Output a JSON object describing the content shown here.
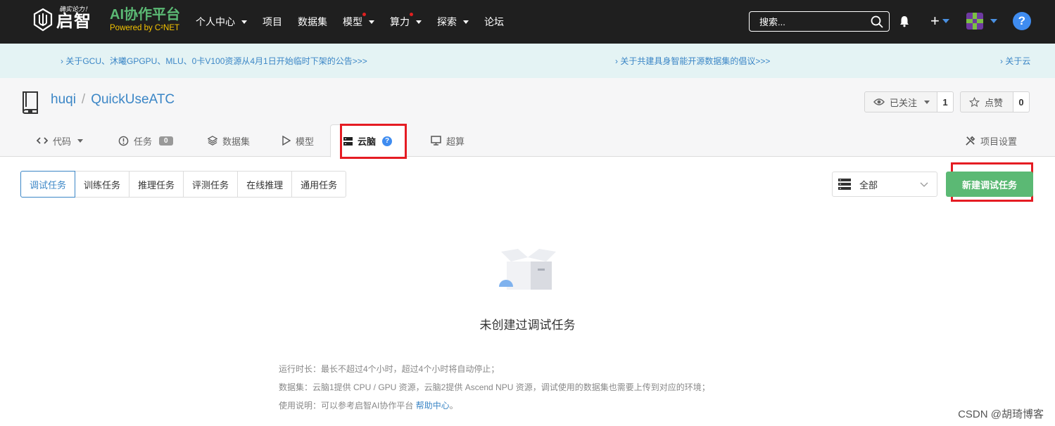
{
  "nav": {
    "logo_slogan": "确实论力！",
    "logo_text": "启智",
    "brand_title": "AI协作平台",
    "brand_sub": "Powered by C²NET",
    "menu": [
      {
        "label": "个人中心",
        "caret": true,
        "dot": false
      },
      {
        "label": "项目",
        "caret": false,
        "dot": false
      },
      {
        "label": "数据集",
        "caret": false,
        "dot": false
      },
      {
        "label": "模型",
        "caret": true,
        "dot": true
      },
      {
        "label": "算力",
        "caret": true,
        "dot": true
      },
      {
        "label": "探索",
        "caret": true,
        "dot": false
      },
      {
        "label": "论坛",
        "caret": false,
        "dot": false
      }
    ],
    "search_placeholder": "搜索...",
    "plus": "+",
    "help": "?"
  },
  "announcements": [
    "› 关于GCU、沐曦GPGPU、MLU、0卡V100资源从4月1日开始临时下架的公告>>>",
    "› 关于共建具身智能开源数据集的倡议>>>",
    "› 关于云"
  ],
  "repo": {
    "owner": "huqi",
    "separator": "/",
    "name": "QuickUseATC",
    "watch_label": "已关注",
    "watch_count": "1",
    "star_label": "点赞",
    "star_count": "0"
  },
  "tabs": {
    "code": "代码",
    "issues": "任务",
    "issues_count": "0",
    "datasets": "数据集",
    "models": "模型",
    "cloudbrain": "云脑",
    "cloudbrain_help": "?",
    "supercompute": "超算",
    "settings": "项目设置"
  },
  "subtabs": [
    "调试任务",
    "训练任务",
    "推理任务",
    "评测任务",
    "在线推理",
    "通用任务"
  ],
  "filter": {
    "selected": "全部"
  },
  "new_button": "新建调试任务",
  "empty": {
    "title": "未创建过调试任务",
    "note1": "运行时长：最长不超过4个小时，超过4个小时将自动停止；",
    "note2": "数据集：云脑1提供 CPU / GPU 资源，云脑2提供 Ascend NPU 资源，调试使用的数据集也需要上传到对应的环境；",
    "note3_prefix": "使用说明：可以参考启智AI协作平台 ",
    "note3_link": "帮助中心",
    "note3_suffix": "。"
  },
  "watermark": "CSDN @胡琦博客",
  "colors": {
    "accent": "#3b86c6",
    "green": "#5bb974",
    "highlight": "#e51c23",
    "nav_bg": "#1f1f1f"
  }
}
